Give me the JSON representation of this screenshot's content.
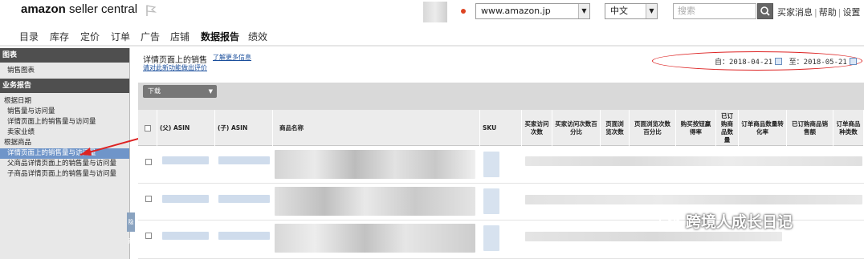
{
  "brand": {
    "name_bold": "amazon",
    "name_light": " seller central"
  },
  "header": {
    "market_value": "www.amazon.jp",
    "language_value": "中文",
    "search_placeholder": "搜索",
    "links": [
      "买家消息",
      "帮助",
      "设置"
    ]
  },
  "nav": [
    "目录",
    "库存",
    "定价",
    "订单",
    "广告",
    "店铺",
    "数据报告",
    "绩效"
  ],
  "nav_active": "数据报告",
  "sidebar": {
    "charts_title": "图表",
    "charts_items": [
      "销售图表"
    ],
    "reports_title": "业务报告",
    "by_date_title": "根据日期",
    "by_date_items": [
      "销售量与访问量",
      "详情页面上的销售量与访问量",
      "卖家业绩"
    ],
    "by_asin_title": "根据商品",
    "by_asin_items": [
      "详情页面上的销售量与访问量",
      "父商品详情页面上的销售量与访问量",
      "子商品详情页面上的销售量与访问量"
    ],
    "toggle": "隐藏"
  },
  "main": {
    "title": "详情页面上的销售",
    "learn_more": "了解更多信息",
    "feedback": "请对此新功能做出评价",
    "date_from_label": "自：",
    "date_from": "2018-04-21",
    "date_to_label": "至：",
    "date_to": "2018-05-21",
    "download": "下载"
  },
  "table": {
    "headers": [
      "(父) ASIN",
      "(子) ASIN",
      "商品名称",
      "SKU",
      "买家访问次数",
      "买家访问次数百分比",
      "页面浏览次数",
      "页面浏览次数百分比",
      "购买按钮赢得率",
      "已订购商品数量",
      "订单商品数量转化率",
      "已订购商品销售额",
      "订单商品种类数"
    ]
  },
  "watermark": "跨境人成长日记",
  "colors": {
    "active_nav_row": "#6f95c9",
    "annotation": "#dd2222",
    "sidebar_header": "#4f4f4f"
  }
}
